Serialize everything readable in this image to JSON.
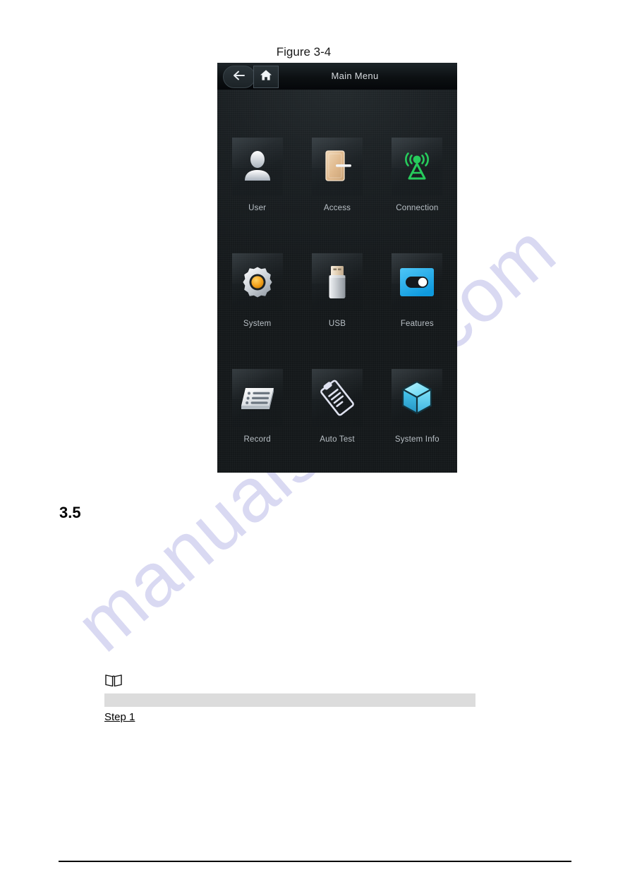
{
  "document": {
    "figure_caption": "Figure 3-4",
    "section_number": "3.5",
    "note_icon": "book-note-icon",
    "highlight_bar_text": "",
    "step_label": "Step 1",
    "watermark": "manualshive.com"
  },
  "device": {
    "header": {
      "back_icon": "back-arrow-icon",
      "home_icon": "home-icon",
      "title": "Main Menu"
    },
    "menu_items": [
      {
        "label": "User",
        "icon": "user-silhouette-icon",
        "color": "#e8eaed"
      },
      {
        "label": "Access",
        "icon": "door-icon",
        "color": "#e2bd92"
      },
      {
        "label": "Connection",
        "icon": "antenna-tower-icon",
        "color": "#27cc5c"
      },
      {
        "label": "System",
        "icon": "gear-icon",
        "color": "#d6d9dd"
      },
      {
        "label": "USB",
        "icon": "usb-drive-icon",
        "color": "#c8ccd1"
      },
      {
        "label": "Features",
        "icon": "toggle-switch-icon",
        "color": "#2ab4ef"
      },
      {
        "label": "Record",
        "icon": "record-list-icon",
        "color": "#e4e7ea"
      },
      {
        "label": "Auto Test",
        "icon": "clipboard-test-icon",
        "color": "#dfe2f0"
      },
      {
        "label": "System Info",
        "icon": "cube-3d-icon",
        "color": "#4fd8f5"
      }
    ]
  },
  "colors": {
    "device_background": "#151a1c",
    "header_background": "#0c1012",
    "title_text": "#d6dade",
    "label_text": "#b9c0c6",
    "accent_green": "#27cc5c",
    "accent_blue": "#2ab4ef",
    "accent_cyan": "#4fd8f5",
    "accent_orange": "#f5a623",
    "accent_tan": "#e2bd92",
    "watermark": "#d9d9f2",
    "highlight_bar": "#dcdcdc"
  }
}
